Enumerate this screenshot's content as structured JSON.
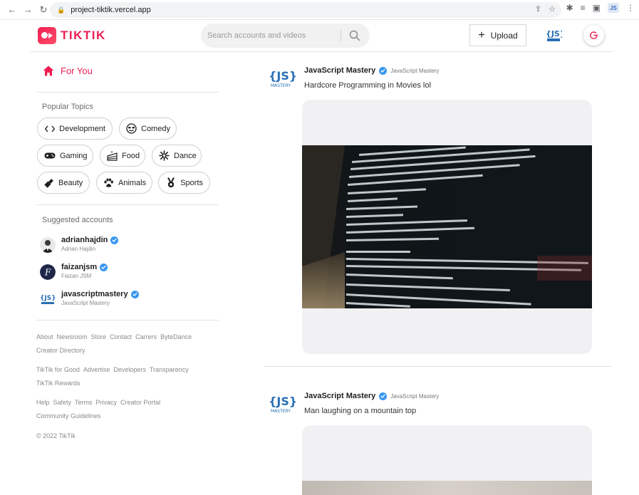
{
  "browser": {
    "url": "project-tiktik.vercel.app"
  },
  "header": {
    "logo_text": "TIKTIK",
    "search_placeholder": "Search accounts and videos",
    "upload_label": "Upload"
  },
  "sidebar": {
    "for_you_label": "For You",
    "popular_topics_heading": "Popular Topics",
    "topics": [
      {
        "label": "Development",
        "icon": "code-icon"
      },
      {
        "label": "Comedy",
        "icon": "sunglasses-face-icon"
      },
      {
        "label": "Gaming",
        "icon": "gamepad-icon"
      },
      {
        "label": "Food",
        "icon": "cake-icon"
      },
      {
        "label": "Dance",
        "icon": "dance-icon"
      },
      {
        "label": "Beauty",
        "icon": "lipstick-icon"
      },
      {
        "label": "Animals",
        "icon": "paw-icon"
      },
      {
        "label": "Sports",
        "icon": "medal-icon"
      }
    ],
    "suggested_heading": "Suggested accounts",
    "accounts": [
      {
        "username": "adrianhajdin",
        "name": "Adrian Hajdin"
      },
      {
        "username": "faizanjsm",
        "name": "Faizan JSM"
      },
      {
        "username": "javascriptmastery",
        "name": "JavaScript Mastery"
      }
    ],
    "footer": {
      "group1": [
        "About",
        "Newsroom",
        "Store",
        "Contact",
        "Carrers",
        "ByteDance",
        "Creator Directory"
      ],
      "group2": [
        "TikTik for Good",
        "Advertise",
        "Developers",
        "Transparency",
        "TikTik Rewards"
      ],
      "group3": [
        "Help",
        "Safety",
        "Terms",
        "Privacy",
        "Creator Portal",
        "Community Guidelines"
      ],
      "copyright": "© 2022 TikTik"
    }
  },
  "feed": {
    "posts": [
      {
        "name": "JavaScript Mastery",
        "handle": "JavaScript Mastery",
        "caption": "Hardcore Programming in Movies lol"
      },
      {
        "name": "JavaScript Mastery",
        "handle": "JavaScript Mastery",
        "caption": "Man laughing on a mountain top"
      }
    ]
  },
  "colors": {
    "brand": "#ee1d52",
    "verified": "#3897f0",
    "avatar_blue": "#2b6fb6"
  }
}
